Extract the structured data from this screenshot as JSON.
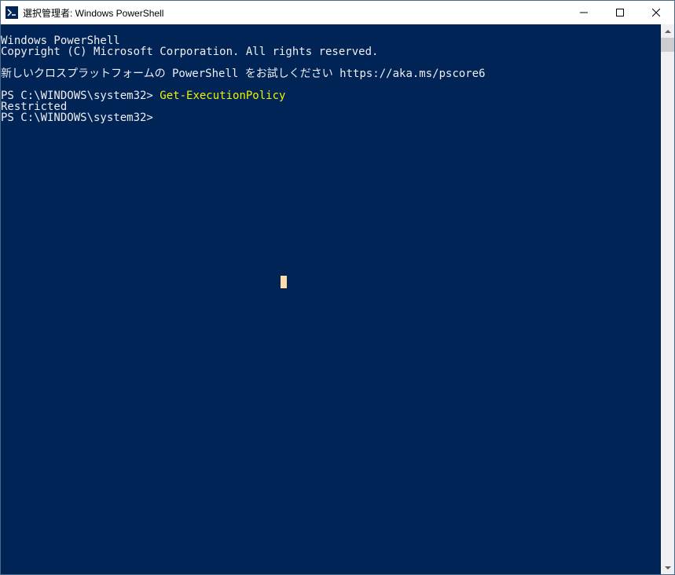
{
  "window": {
    "title": "選択管理者: Windows PowerShell"
  },
  "terminal": {
    "line1": "Windows PowerShell",
    "line2": "Copyright (C) Microsoft Corporation. All rights reserved.",
    "line3": "",
    "line4": "新しいクロスプラットフォームの PowerShell をお試しください https://aka.ms/pscore6",
    "line5": "",
    "prompt1": "PS C:\\WINDOWS\\system32> ",
    "command1": "Get-ExecutionPolicy",
    "output1": "Restricted",
    "prompt2": "PS C:\\WINDOWS\\system32>"
  }
}
